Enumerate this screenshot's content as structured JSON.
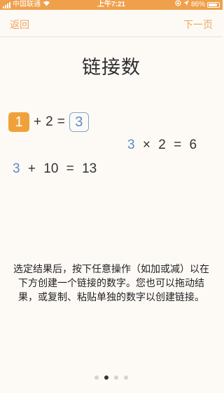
{
  "status_bar": {
    "carrier": "中国联通",
    "time": "上午7:21",
    "battery": "86%"
  },
  "nav": {
    "back_label": "返回",
    "next_label": "下一页"
  },
  "title": "链接数",
  "eq1": {
    "a": "1",
    "op": "+",
    "b": "2",
    "eq": "=",
    "result": "3"
  },
  "eq2": {
    "a": "3",
    "op": "×",
    "b": "2",
    "eq": "=",
    "result": "6"
  },
  "eq3": {
    "a": "3",
    "op": "+",
    "b": "10",
    "eq": "=",
    "result": "13"
  },
  "description": "选定结果后，按下任意操作（如加或减）以在下方创建一个链接的数字。您也可以拖动结果，或复制、粘贴单独的数字以创建链接。",
  "pager": {
    "count": 4,
    "active_index": 1
  },
  "colors": {
    "accent": "#efa45a",
    "link_blue": "#5a8bc8",
    "status_bar": "#f0a04b"
  }
}
